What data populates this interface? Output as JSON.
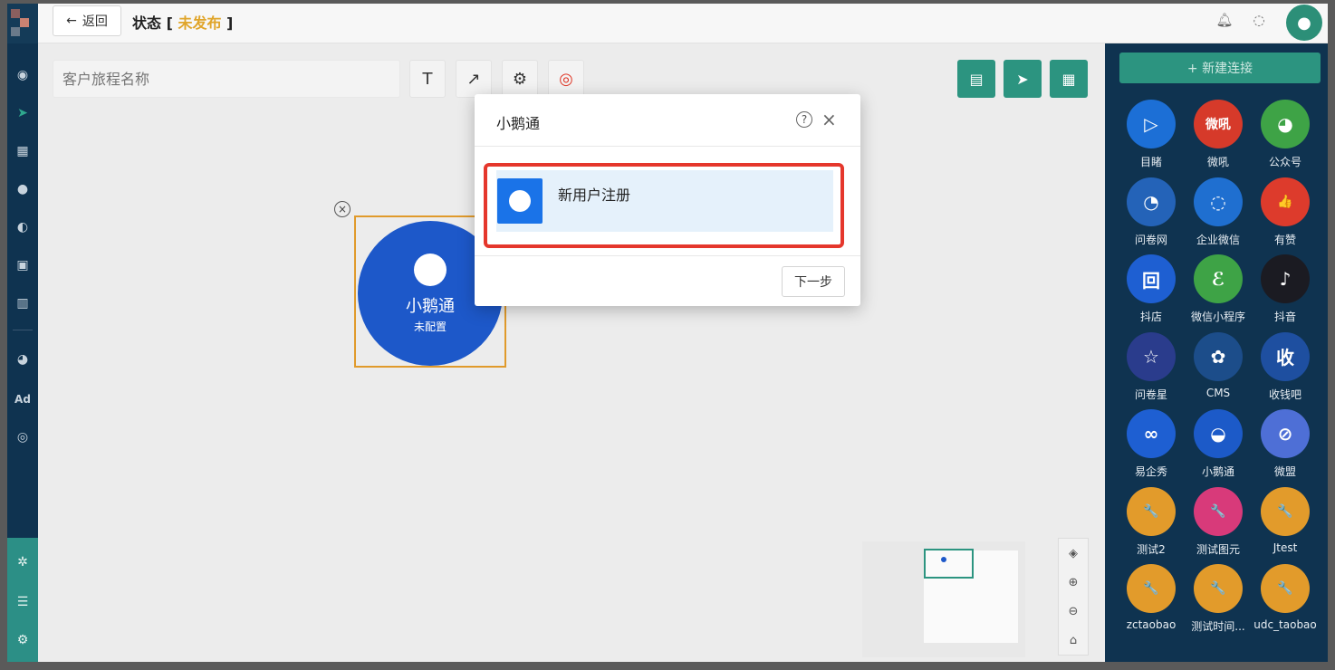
{
  "header": {
    "back_label": "返回",
    "status_prefix": "状态 [ ",
    "status_value": "未发布",
    "status_suffix": " ]"
  },
  "toolbar": {
    "journey_name_placeholder": "客户旅程名称",
    "text_tool_glyph": "T",
    "arrow_tool_glyph": "↗",
    "settings_glyph": "⚙",
    "target_glyph": "◎"
  },
  "node": {
    "title": "小鹅通",
    "subtitle": "未配置"
  },
  "right_panel": {
    "new_connection_label": "+ 新建连接",
    "connectors": [
      {
        "label": "目睹",
        "icon": "play-icon",
        "glyph": "▷",
        "color": "#1c6fd6"
      },
      {
        "label": "微吼",
        "icon": "weihou-icon",
        "glyph": "微吼",
        "color": "#d63a2a"
      },
      {
        "label": "公众号",
        "icon": "wechat-icon",
        "glyph": "◕",
        "color": "#3ea346"
      },
      {
        "label": "问卷网",
        "icon": "questionnaire-icon",
        "glyph": "◔",
        "color": "#2463b8"
      },
      {
        "label": "企业微信",
        "icon": "wecom-icon",
        "glyph": "◌",
        "color": "#1f6fd0"
      },
      {
        "label": "有赞",
        "icon": "thumbs-up-icon",
        "glyph": "👍",
        "color": "#dd3b2c"
      },
      {
        "label": "抖店",
        "icon": "doudian-icon",
        "glyph": "回",
        "color": "#1e5fd2"
      },
      {
        "label": "微信小程序",
        "icon": "miniprogram-icon",
        "glyph": "ℰ",
        "color": "#3ea346"
      },
      {
        "label": "抖音",
        "icon": "douyin-icon",
        "glyph": "♪",
        "color": "#1b1b22"
      },
      {
        "label": "问卷星",
        "icon": "star-icon",
        "glyph": "☆",
        "color": "#2a3c8c"
      },
      {
        "label": "CMS",
        "icon": "cms-icon",
        "glyph": "✿",
        "color": "#1c4d8a"
      },
      {
        "label": "收钱吧",
        "icon": "shouqianba-icon",
        "glyph": "收",
        "color": "#1e4fa0"
      },
      {
        "label": "易企秀",
        "icon": "eqxiu-icon",
        "glyph": "∞",
        "color": "#1e5fd2"
      },
      {
        "label": "小鹅通",
        "icon": "xiaoetong-icon",
        "glyph": "◒",
        "color": "#1c5ac8"
      },
      {
        "label": "微盟",
        "icon": "weimob-icon",
        "glyph": "⊘",
        "color": "#4e6fd6"
      },
      {
        "label": "测试2",
        "icon": "wrench-icon",
        "glyph": "🔧",
        "color": "#e29b2b"
      },
      {
        "label": "测试图元",
        "icon": "wrench-icon",
        "glyph": "🔧",
        "color": "#d83a7a"
      },
      {
        "label": "Jtest",
        "icon": "wrench-icon",
        "glyph": "🔧",
        "color": "#e29b2b"
      },
      {
        "label": "zctaobao",
        "icon": "wrench-icon",
        "glyph": "🔧",
        "color": "#e29b2b"
      },
      {
        "label": "测试时间...",
        "icon": "wrench-icon",
        "glyph": "🔧",
        "color": "#e29b2b"
      },
      {
        "label": "udc_taobao",
        "icon": "wrench-icon",
        "glyph": "🔧",
        "color": "#e29b2b"
      }
    ]
  },
  "modal": {
    "title": "小鹅通",
    "help_glyph": "?",
    "close_glyph": "×",
    "option_label": "新用户注册",
    "next_label": "下一步"
  }
}
